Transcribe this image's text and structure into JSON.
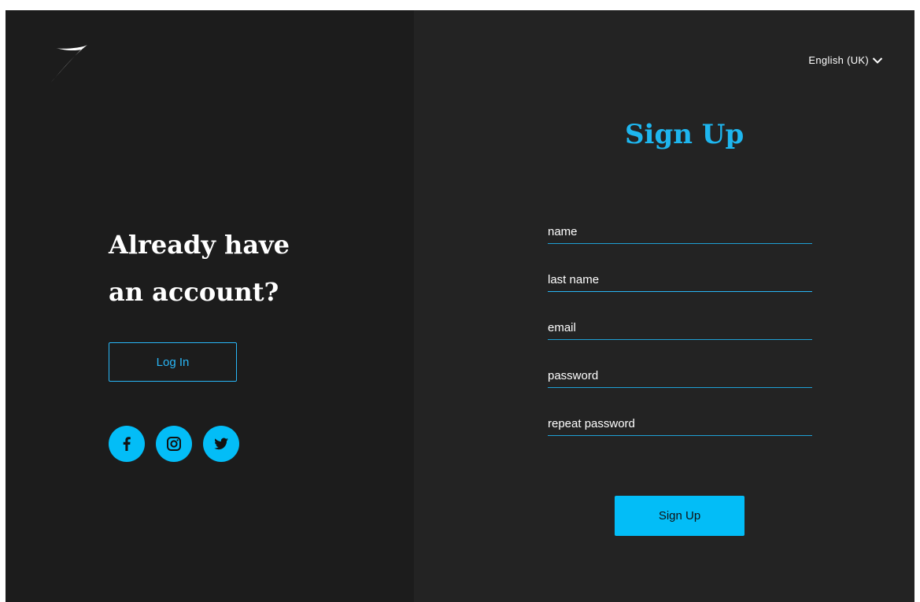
{
  "left": {
    "headline_line1": "Already have",
    "headline_line2": "an account?",
    "login_label": "Log In",
    "socials": [
      "facebook-icon",
      "instagram-icon",
      "twitter-icon"
    ]
  },
  "right": {
    "language": "English (UK)",
    "title": "Sign Up",
    "fields": [
      {
        "placeholder": "name",
        "value": ""
      },
      {
        "placeholder": "last name",
        "value": ""
      },
      {
        "placeholder": "email",
        "value": ""
      },
      {
        "placeholder": "password",
        "value": ""
      },
      {
        "placeholder": "repeat password",
        "value": ""
      }
    ],
    "submit_label": "Sign Up"
  },
  "colors": {
    "accent": "#03bdf7",
    "left_bg": "#1c1c1c",
    "right_bg": "#232323",
    "text": "#ffffff"
  }
}
